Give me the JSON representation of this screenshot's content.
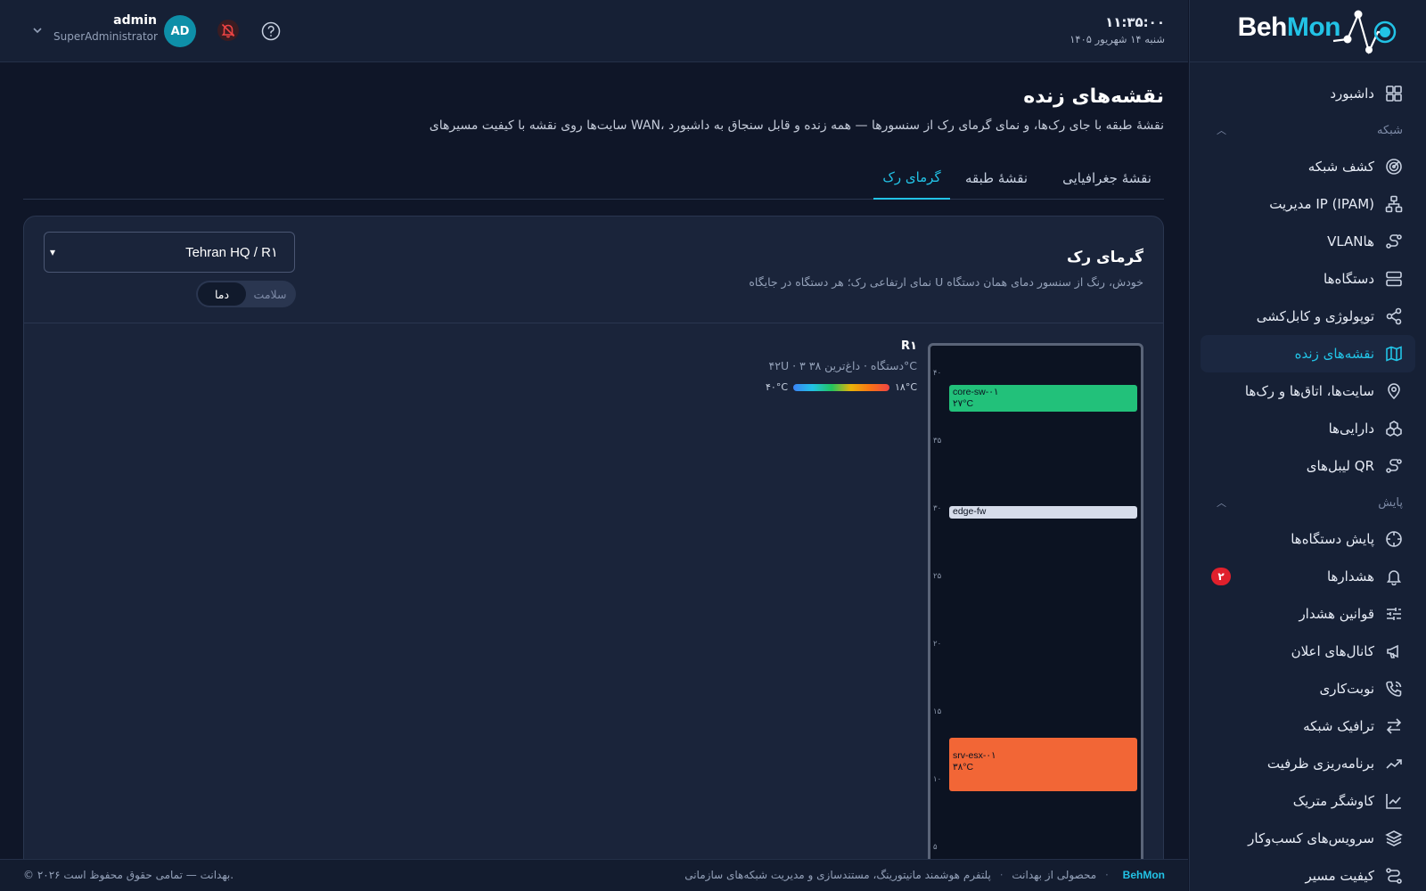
{
  "brand": {
    "part1": "Beh",
    "part2": "Mon"
  },
  "topbar": {
    "time": "۱۱:۳۵:۰۰",
    "date": "شنبه ۱۴ شهریور ۱۴۰۵",
    "user_name": "admin",
    "user_role": "SuperAdministrator",
    "avatar_initials": "AD"
  },
  "sidebar": {
    "items": [
      {
        "label": "داشبورد",
        "icon": "dashboard-icon"
      },
      {
        "section": "شبکه"
      },
      {
        "label": "کشف شبکه",
        "icon": "radar-icon"
      },
      {
        "label": "مدیریت IP (IPAM)",
        "icon": "network-tree-icon"
      },
      {
        "label": "VLANها",
        "icon": "route-icon"
      },
      {
        "label": "دستگاه‌ها",
        "icon": "server-icon"
      },
      {
        "label": "توپولوژی و کابل‌کشی",
        "icon": "share-icon"
      },
      {
        "label": "نقشه‌های زنده",
        "icon": "map-icon",
        "active": true
      },
      {
        "label": "سایت‌ها، اتاق‌ها و رک‌ها",
        "icon": "location-pin-icon"
      },
      {
        "label": "دارایی‌ها",
        "icon": "boxes-icon"
      },
      {
        "label": "لیبل‌های QR",
        "icon": "route-icon"
      },
      {
        "section": "پایش"
      },
      {
        "label": "پایش دستگاه‌ها",
        "icon": "crosshair-icon"
      },
      {
        "label": "هشدارها",
        "icon": "bell-icon",
        "badge": "۲"
      },
      {
        "label": "قوانین هشدار",
        "icon": "sliders-icon"
      },
      {
        "label": "کانال‌های اعلان",
        "icon": "megaphone-icon"
      },
      {
        "label": "نوبت‌کاری",
        "icon": "phone-icon"
      },
      {
        "label": "ترافیک شبکه",
        "icon": "arrows-icon"
      },
      {
        "label": "برنامه‌ریزی ظرفیت",
        "icon": "trend-icon"
      },
      {
        "label": "کاوشگر متریک",
        "icon": "chart-icon"
      },
      {
        "label": "سرویس‌های کسب‌وکار",
        "icon": "layers-icon"
      },
      {
        "label": "کیفیت مسیر",
        "icon": "route-quality-icon"
      }
    ]
  },
  "page": {
    "title": "نقشه‌های زنده",
    "subtitle": "سایت‌ها روی نقشه با کیفیت مسیرهای WAN، نقشهٔ طبقه با جای رک‌ها، و نمای گرمای رک از سنسورها — همه زنده و قابل سنجاق به داشبورد",
    "tabs": [
      "نقشهٔ جغرافیایی",
      "نقشهٔ طبقه",
      "گرمای رک"
    ],
    "active_tab": 2
  },
  "card": {
    "title": "گرمای رک",
    "subtitle": "نمای ارتفاعی رک؛ هر دستگاه در جایگاه U خودش، رنگ از سنسور دمای همان دستگاه",
    "rack_select": "Tehran HQ / R۱",
    "modes": [
      "سلامت",
      "دما"
    ],
    "active_mode": 1
  },
  "rack": {
    "name": "R۱",
    "meta": "۴۲U · ۳ دستگاه · داغ‌ترین ۳۸°C",
    "legend_min": "۱۸°C",
    "legend_max": "۴۰°C",
    "total_u": 42,
    "u_labels": [
      "۴۰",
      "۳۵",
      "۳۰",
      "۲۵",
      "۲۰",
      "۱۵",
      "۱۰",
      "۵"
    ],
    "devices": [
      {
        "name": "core-sw-۰۱",
        "temp": "۲۷°C",
        "temp_value": 27,
        "color": "#22c17a"
      },
      {
        "name": "edge-fw",
        "temp": "",
        "color": "#d6dcea"
      },
      {
        "name": "srv-esx-۰۱",
        "temp": "۳۸°C",
        "temp_value": 38,
        "color": "#f26636"
      }
    ]
  },
  "footer": {
    "brand": "BehMon",
    "tagline": "پلتفرم هوشمند مانیتورینگ، مستندسازی و مدیریت شبکه‌های سازمانی",
    "product_of": "محصولی از بهدانت",
    "copyright": "© ۲۰۲۶ بهدانت — تمامی حقوق محفوظ است."
  },
  "colors": {
    "accent": "#22c3e6",
    "alert_badge": "#e0202c",
    "avatar": "#0e8fa8"
  }
}
